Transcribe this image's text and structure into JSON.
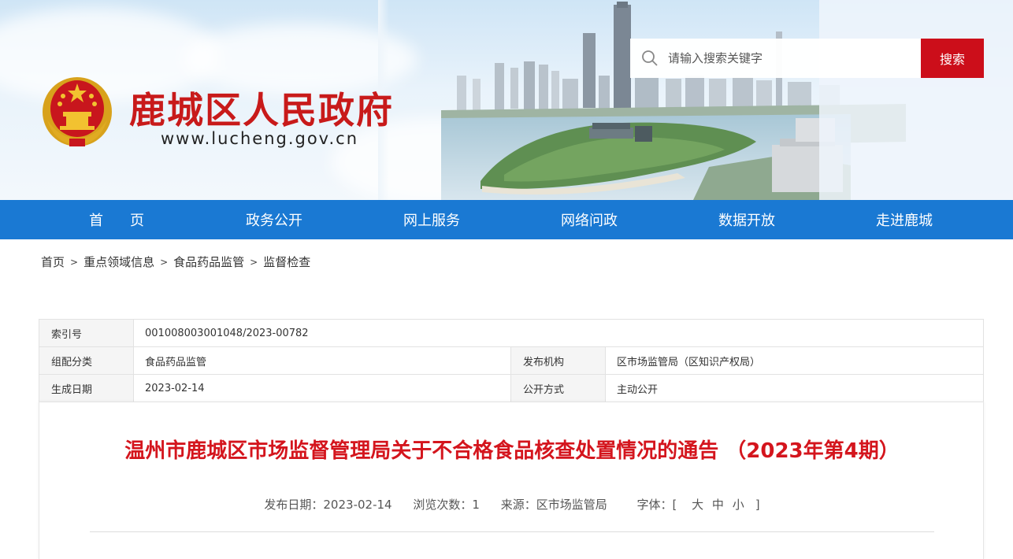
{
  "header": {
    "site_title": "鹿城区人民政府",
    "site_url": "www.lucheng.gov.cn",
    "search_placeholder": "请输入搜索关键字",
    "search_button": "搜索"
  },
  "nav": {
    "items": [
      {
        "label": "首页"
      },
      {
        "label": "政务公开"
      },
      {
        "label": "网上服务"
      },
      {
        "label": "网络问政"
      },
      {
        "label": "数据开放"
      },
      {
        "label": "走进鹿城"
      }
    ]
  },
  "breadcrumb": {
    "items": [
      "首页",
      "重点领域信息",
      "食品药品监管",
      "监督检查"
    ],
    "separator": ">"
  },
  "meta": {
    "index_label": "索引号",
    "index_value": "001008003001048/2023-00782",
    "category_label": "组配分类",
    "category_value": "食品药品监管",
    "publisher_label": "发布机构",
    "publisher_value": "区市场监管局（区知识产权局）",
    "date_label": "生成日期",
    "date_value": "2023-02-14",
    "mode_label": "公开方式",
    "mode_value": "主动公开"
  },
  "article": {
    "title": "温州市鹿城区市场监督管理局关于不合格食品核查处置情况的通告 （2023年第4期）",
    "publish_date": "发布日期：2023-02-14",
    "views": "浏览次数：1",
    "source": "来源：区市场监管局",
    "font_label": "字体：[",
    "font_large": "大",
    "font_medium": "中",
    "font_small": "小",
    "font_close": "]"
  },
  "colors": {
    "brand_red": "#cc0e1a",
    "nav_blue": "#1a79d3",
    "title_red": "#d4151d"
  }
}
